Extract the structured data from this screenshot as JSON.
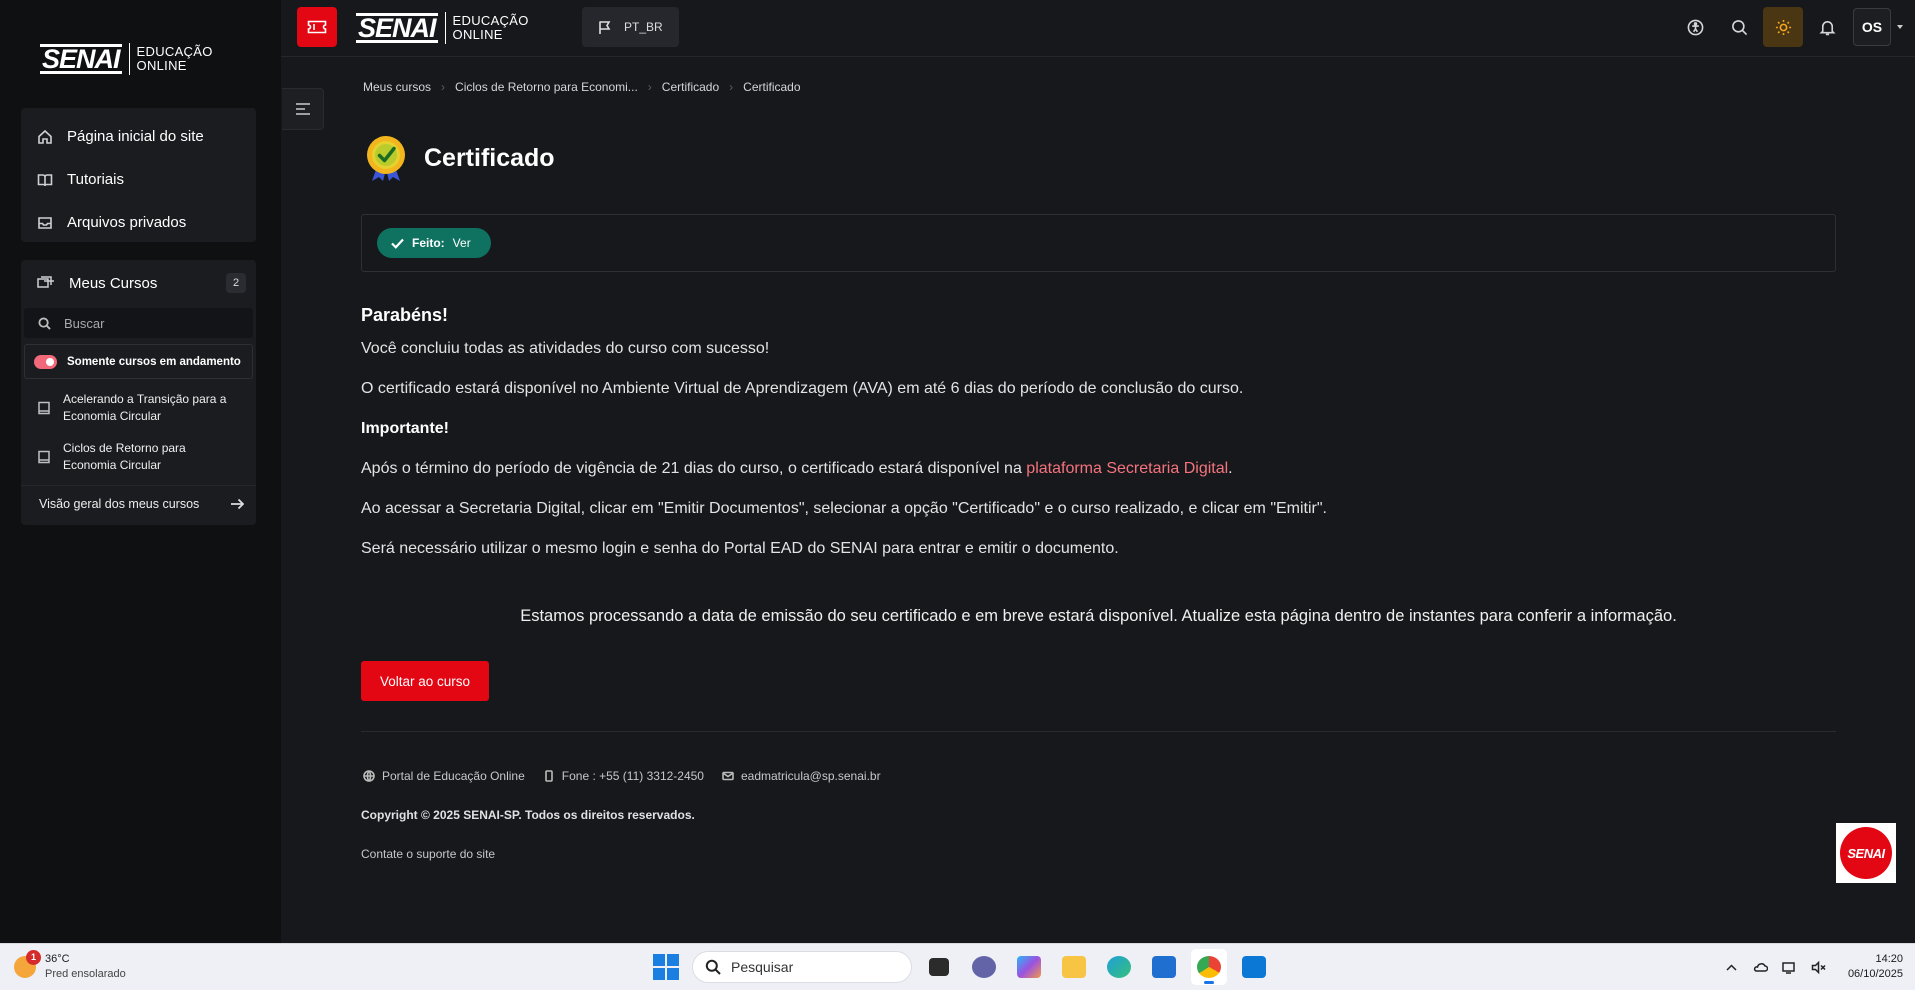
{
  "brand": {
    "logo_word": "SENAI",
    "logo_line1": "EDUCAÇÃO",
    "logo_line2": "ONLINE",
    "red": "#e30613"
  },
  "sidebar": {
    "nav": [
      {
        "label": "Página inicial do site",
        "icon": "home-icon"
      },
      {
        "label": "Tutoriais",
        "icon": "book-icon"
      },
      {
        "label": "Arquivos privados",
        "icon": "inbox-icon"
      }
    ],
    "courses_title": "Meus Cursos",
    "courses_count": "2",
    "search_placeholder": "Buscar",
    "toggle_label": "Somente cursos em andamento",
    "courses": [
      {
        "line1": "Acelerando a Transição para a",
        "line2": "Economia Circular"
      },
      {
        "line1": "Ciclos de Retorno para",
        "line2": "Economia Circular"
      }
    ],
    "overview_label": "Visão geral dos meus cursos"
  },
  "topbar": {
    "language": "PT_BR",
    "avatar_initials": "OS"
  },
  "breadcrumb": [
    "Meus cursos",
    "Ciclos de Retorno para Economi...",
    "Certificado",
    "Certificado"
  ],
  "page": {
    "title": "Certificado",
    "completion_label": "Feito:",
    "completion_value": "Ver",
    "heading": "Parabéns!",
    "p1": "Você concluiu todas as atividades do curso com sucesso!",
    "p2": "O certificado estará disponível no Ambiente Virtual de Aprendizagem (AVA) em até 6 dias do período de conclusão do curso.",
    "important": "Importante!",
    "p3_before": "Após o término do período de vigência de 21 dias do curso, o certificado estará disponível na ",
    "p3_link": "plataforma Secretaria Digital",
    "p3_after": ".",
    "p4": "Ao acessar a Secretaria Digital, clicar em \"Emitir Documentos\", selecionar a opção \"Certificado\" e o curso realizado, e clicar em \"Emitir\".",
    "p5": "Será necessário utilizar o mesmo login e senha do Portal EAD do SENAI para entrar e emitir o documento.",
    "processing": "Estamos processando a data de emissão do seu certificado e em breve estará disponível. Atualize esta página dentro de instantes para conferir a informação.",
    "back_button": "Voltar ao curso"
  },
  "footer": {
    "portal": "Portal de Educação Online",
    "phone": "Fone : +55 (11) 3312-2450",
    "email": "eadmatricula@sp.senai.br",
    "copyright": "Copyright © 2025 SENAI-SP. Todos os direitos reservados.",
    "support": "Contate o suporte do site",
    "badge": "SENAI"
  },
  "taskbar": {
    "temperature": "36°C",
    "weather": "Pred ensolarado",
    "weather_badge": "1",
    "search_placeholder": "Pesquisar",
    "time": "14:20",
    "date": "06/10/2025"
  }
}
